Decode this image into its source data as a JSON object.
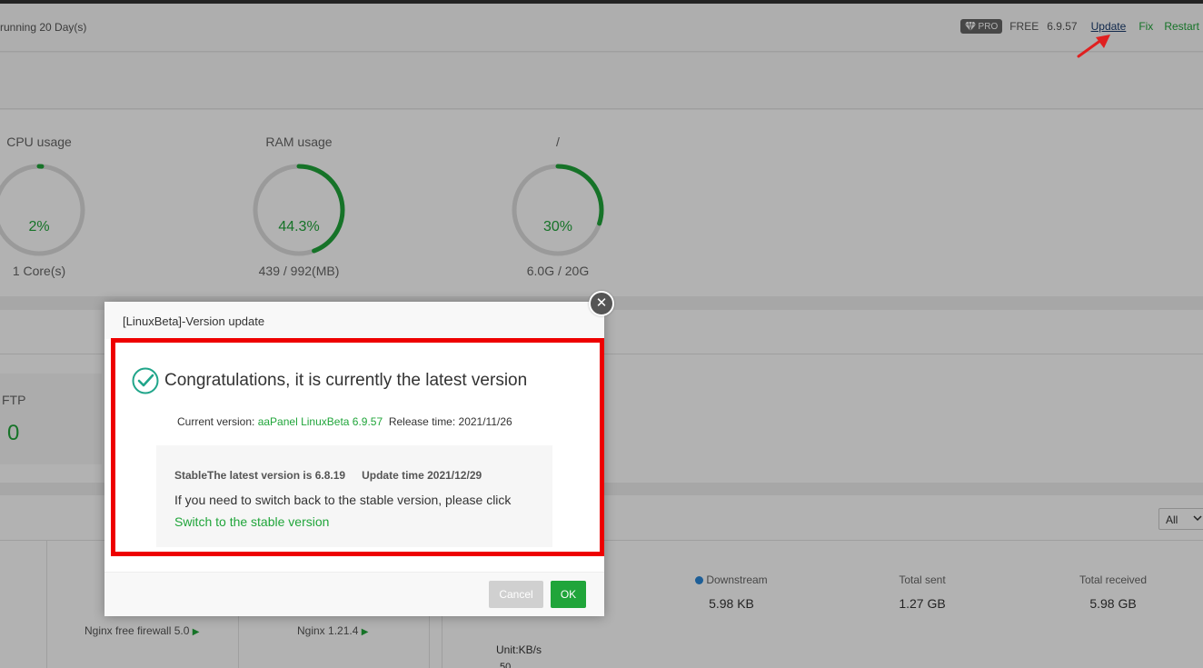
{
  "topbar": {
    "running": "running 20 Day(s)",
    "pro_badge": "PRO",
    "free_label": "FREE",
    "version": "6.9.57",
    "update_link": "Update",
    "fix_link": "Fix",
    "restart_link": "Restart"
  },
  "gauges": [
    {
      "title": "CPU usage",
      "value": "2%",
      "sub": "1 Core(s)",
      "fraction": 0.02
    },
    {
      "title": "RAM usage",
      "value": "44.3%",
      "sub": "439 / 992(MB)",
      "fraction": 0.443
    },
    {
      "title": "/",
      "value": "30%",
      "sub": "6.0G / 20G",
      "fraction": 0.3
    }
  ],
  "stats": {
    "ftp_label": "FTP",
    "ftp_value": "0"
  },
  "software": {
    "plugin1": "Nginx free firewall 5.0",
    "plugin2": "Nginx 1.21.4"
  },
  "network": {
    "filter": "All",
    "downstream_label": "Downstream",
    "downstream_value": "5.98 KB",
    "total_sent_label": "Total sent",
    "total_sent_value": "1.27 GB",
    "total_received_label": "Total received",
    "total_received_value": "5.98 GB",
    "unit": "Unit:KB/s",
    "axis_top": "50"
  },
  "dialog": {
    "title": "[LinuxBeta]-Version update",
    "congrats": "Congratulations, it is currently the latest version",
    "current_label": "Current version: ",
    "current_value": "aaPanel LinuxBeta 6.9.57",
    "release_label": "Release time: 2021/11/26",
    "stable_line": "StableThe latest version is 6.8.19",
    "update_time": "Update time  2021/12/29",
    "switch_text": "If you need to switch back to the stable version, please click ",
    "switch_link": "Switch to the stable version",
    "cancel": "Cancel",
    "ok": "OK"
  },
  "colors": {
    "accent_green": "#20a53a",
    "highlight_red": "#ee0000",
    "arrow_red": "#e02020"
  }
}
